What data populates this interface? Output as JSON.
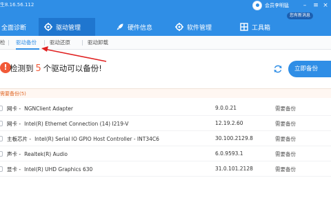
{
  "app": {
    "title": "生8.16.56.112",
    "user_name": "会员李明猛",
    "member_badge": "您有新消息"
  },
  "nav": {
    "tabs": [
      {
        "label": "全面诊断",
        "icon": "stethoscope-icon"
      },
      {
        "label": "驱动管理",
        "icon": "gear-icon"
      },
      {
        "label": "硬件信息",
        "icon": "rocket-icon"
      },
      {
        "label": "软件管理",
        "icon": "gear-icon"
      },
      {
        "label": "工具箱",
        "icon": "toolbox-icon"
      }
    ],
    "active": "驱动管理"
  },
  "subtabs": {
    "items": [
      "检",
      "驱动备份",
      "驱动还原",
      "驱动卸载"
    ],
    "active": "驱动备份"
  },
  "banner": {
    "prefix": "检测到",
    "count": "5",
    "suffix": "个驱动可以备份!",
    "action_label": "立即备份"
  },
  "section": {
    "label": "需要备份(5)"
  },
  "drivers": [
    {
      "category": "网卡 -",
      "name": "NGNClient Adapter",
      "version": "9.0.0.21",
      "status": "需要备份"
    },
    {
      "category": "网卡 -",
      "name": "Intel(R) Ethernet Connection (14) I219-V",
      "version": "12.19.2.60",
      "status": "需要备份"
    },
    {
      "category": "主板芯片 -",
      "name": "Intel(R) Serial IO GPIO Host Controller - INT34C6",
      "version": "30.100.2129.8",
      "status": "需要备份"
    },
    {
      "category": "声卡 -",
      "name": "Realtek(R) Audio",
      "version": "6.0.9593.1",
      "status": "需要备份"
    },
    {
      "category": "显卡 -",
      "name": "Intel(R) UHD Graphics 630",
      "version": "31.0.101.2128",
      "status": "需要备份"
    }
  ],
  "colors": {
    "header": "#2f8ee6",
    "active_tab": "#1f76cf",
    "accent_red": "#f15a38",
    "section_orange": "#e06a2a"
  }
}
